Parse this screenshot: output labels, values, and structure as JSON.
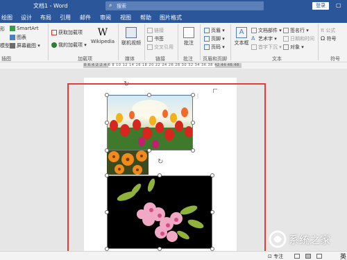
{
  "titlebar": {
    "doc_title": "文档1 - Word",
    "search_placeholder": "搜索",
    "login_label": "登录"
  },
  "tabs": [
    {
      "label": "绘图"
    },
    {
      "label": "设计"
    },
    {
      "label": "布局"
    },
    {
      "label": "引用"
    },
    {
      "label": "邮件"
    },
    {
      "label": "审阅"
    },
    {
      "label": "视图"
    },
    {
      "label": "帮助"
    },
    {
      "label": "图片格式"
    }
  ],
  "ribbon": {
    "illustrations": {
      "items": [
        "SmartArt",
        "图表",
        "屏幕截图"
      ],
      "left_items": [
        "形",
        "模型"
      ],
      "group_label": "插图"
    },
    "addins": {
      "get_addins": "获取加载项",
      "my_addins": "我的加载项",
      "wikipedia": "Wikipedia",
      "group_label": "加载项"
    },
    "media": {
      "online_video": "联机视频",
      "group_label": "媒体"
    },
    "links": {
      "items": [
        "链接",
        "书签",
        "交叉引用"
      ],
      "group_label": "链接"
    },
    "comments": {
      "comment": "批注",
      "group_label": "批注"
    },
    "header_footer": {
      "items": [
        "页眉",
        "页脚",
        "页码"
      ],
      "group_label": "页眉和页脚"
    },
    "text": {
      "textbox": "文本框",
      "items": [
        "文档部件",
        "艺术字",
        "首字下沉"
      ],
      "items2": [
        "签名行",
        "日期和时间",
        "对象"
      ],
      "group_label": "文本"
    },
    "symbols": {
      "items": [
        "公式",
        "符号"
      ],
      "symbol_big": "符号",
      "group_label": "符号"
    }
  },
  "ruler": {
    "numbers": "8 6 4 2     2 4 6 8 10 12 14 16 18 20 22 24 26 28 30 32 34 36 38   42 44 46 48"
  },
  "status": {
    "focus_label": "专注",
    "language": "英"
  },
  "watermark": {
    "text": "系统之家"
  }
}
